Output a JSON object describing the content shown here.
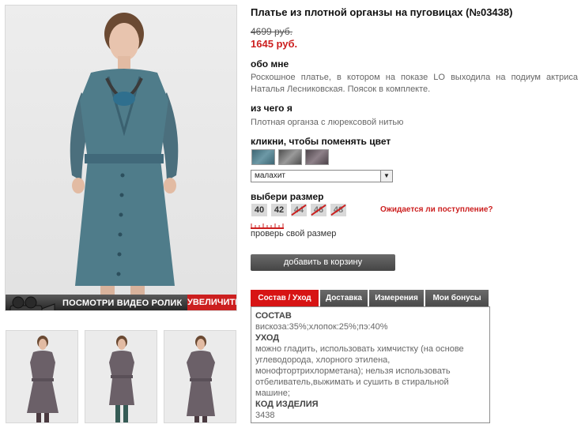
{
  "product": {
    "title": "Платье из плотной органзы на пуговицах (№03438)",
    "old_price": "4699 руб.",
    "new_price": "1645 руб."
  },
  "about": {
    "heading": "обо мне",
    "text": "Роскошное платье, в котором на показе LO выходила на подиум актриса Наталья Лесниковская. Поясок в комплекте."
  },
  "material": {
    "heading": "из чего я",
    "text": "Плотная органза с люрексовой нитью"
  },
  "color": {
    "heading": "кликни, чтобы поменять цвет",
    "swatches": [
      "#4f7c8a",
      "#6f6f6f",
      "#6b6168"
    ],
    "selected": "малахит"
  },
  "size": {
    "heading": "выбери размер",
    "options": [
      {
        "label": "40",
        "available": true
      },
      {
        "label": "42",
        "available": true
      },
      {
        "label": "44",
        "available": false
      },
      {
        "label": "46",
        "available": false
      },
      {
        "label": "48",
        "available": false
      }
    ],
    "wait_link": "Ожидается ли поступление?",
    "check_link": "проверь свой размер"
  },
  "cart_button": "добавить в корзину",
  "photo": {
    "video_label": "ПОСМОТРИ ВИДЕО РОЛИК",
    "zoom_label": "УВЕЛИЧИТЬ"
  },
  "tabs": [
    {
      "label": "Состав / Уход",
      "active": true
    },
    {
      "label": "Доставка",
      "active": false
    },
    {
      "label": "Измерения",
      "active": false
    },
    {
      "label": "Мои бонусы",
      "active": false
    }
  ],
  "panel": {
    "composition_heading": "СОСТАВ",
    "composition": "вискоза:35%;хлопок:25%;пэ:40%",
    "care_heading": "УХОД",
    "care": "можно гладить, использовать химчистку (на основе углеводорода, хлорного этилена, монофтортрихлорметана); нельзя использовать отбеливатель,выжимать и сушить в стиральной машине;",
    "code_heading": "КОД ИЗДЕЛИЯ",
    "code": "3438"
  }
}
